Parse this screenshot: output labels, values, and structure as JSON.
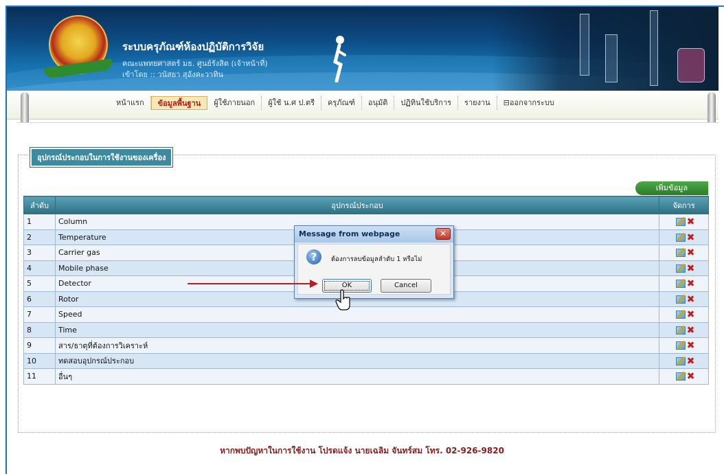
{
  "header": {
    "title": "ระบบครุภัณฑ์ห้องปฏิบัติการวิจัย",
    "faculty": "คณะแพทยศาสตร์ มธ. ศูนย์รังสิต (เจ้าหน้าที่)",
    "login_label": "เข้าโดย :: วนัสยา สุอังคะวาทิน"
  },
  "menu": [
    {
      "label": "หน้าแรก"
    },
    {
      "label": "ข้อมูลพื้นฐาน",
      "active": true
    },
    {
      "label": "ผู้ใช้ภายนอก"
    },
    {
      "label": "ผู้ใช้ น.ศ ป.ตรี"
    },
    {
      "label": "ครุภัณฑ์"
    },
    {
      "label": "อนุมัติ"
    },
    {
      "label": "ปฏิทินใช้บริการ"
    },
    {
      "label": "รายงาน"
    },
    {
      "label": "ออกจากระบบ"
    }
  ],
  "section": {
    "legend": "อุปกรณ์ประกอบในการใช้งานของเครื่อง",
    "add_button": "เพิ่มข้อมูล"
  },
  "table": {
    "headers": [
      "ลำดับ",
      "อุปกรณ์ประกอบ",
      "จัดการ"
    ],
    "rows": [
      {
        "no": "1",
        "name": "Column"
      },
      {
        "no": "2",
        "name": "Temperature"
      },
      {
        "no": "3",
        "name": "Carrier gas"
      },
      {
        "no": "4",
        "name": "Mobile phase"
      },
      {
        "no": "5",
        "name": "Detector"
      },
      {
        "no": "6",
        "name": "Rotor"
      },
      {
        "no": "7",
        "name": "Speed"
      },
      {
        "no": "8",
        "name": "Time"
      },
      {
        "no": "9",
        "name": "สาร/ธาตุที่ต้องการวิเคราะห์"
      },
      {
        "no": "10",
        "name": "ทดสอบอุปกรณ์ประกอบ"
      },
      {
        "no": "11",
        "name": "อื่นๆ"
      }
    ]
  },
  "dialog": {
    "title": "Message from webpage",
    "message": "ต้องการลบข้อมูลลำดับ 1 หรือไม่",
    "ok_label": "OK",
    "cancel_label": "Cancel"
  },
  "footer": {
    "text": "หากพบปัญหาในการใช้งาน โปรดแจ้ง นายเฉลิม จันทร์สม โทร. 02-926-9820"
  },
  "colors": {
    "banner": "#0d4a83",
    "accent": "#3b8a9f",
    "active_menu": "#b31b1b",
    "footer_text": "#8a1c1c"
  }
}
